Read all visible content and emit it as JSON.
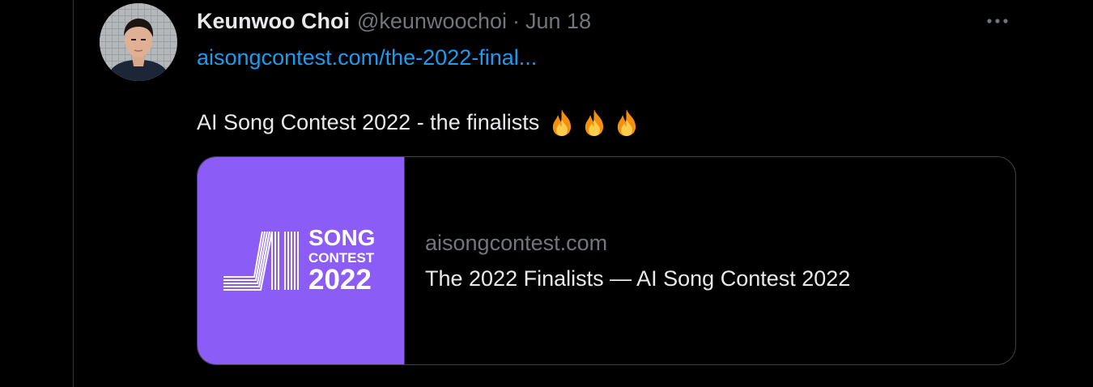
{
  "tweet": {
    "author_name": "Keunwoo Choi",
    "author_handle": "@keunwoochoi",
    "separator": "·",
    "date": "Jun 18",
    "link_text": "aisongcontest.com/the-2022-final...",
    "text": "AI Song Contest 2022 - the finalists",
    "emojis": [
      "fire-icon",
      "fire-icon",
      "fire-icon"
    ],
    "more_icon": "more-horizontal-icon"
  },
  "card": {
    "logo": {
      "song": "SONG",
      "contest": "CONTEST",
      "year": "2022"
    },
    "domain": "aisongcontest.com",
    "title": "The 2022 Finalists — AI Song Contest 2022"
  },
  "colors": {
    "background": "#000000",
    "text_primary": "#e7e9ea",
    "text_secondary": "#71767b",
    "link": "#1d9bf0",
    "card_border": "#3e4144",
    "card_image_bg": "#8b5cf6"
  }
}
